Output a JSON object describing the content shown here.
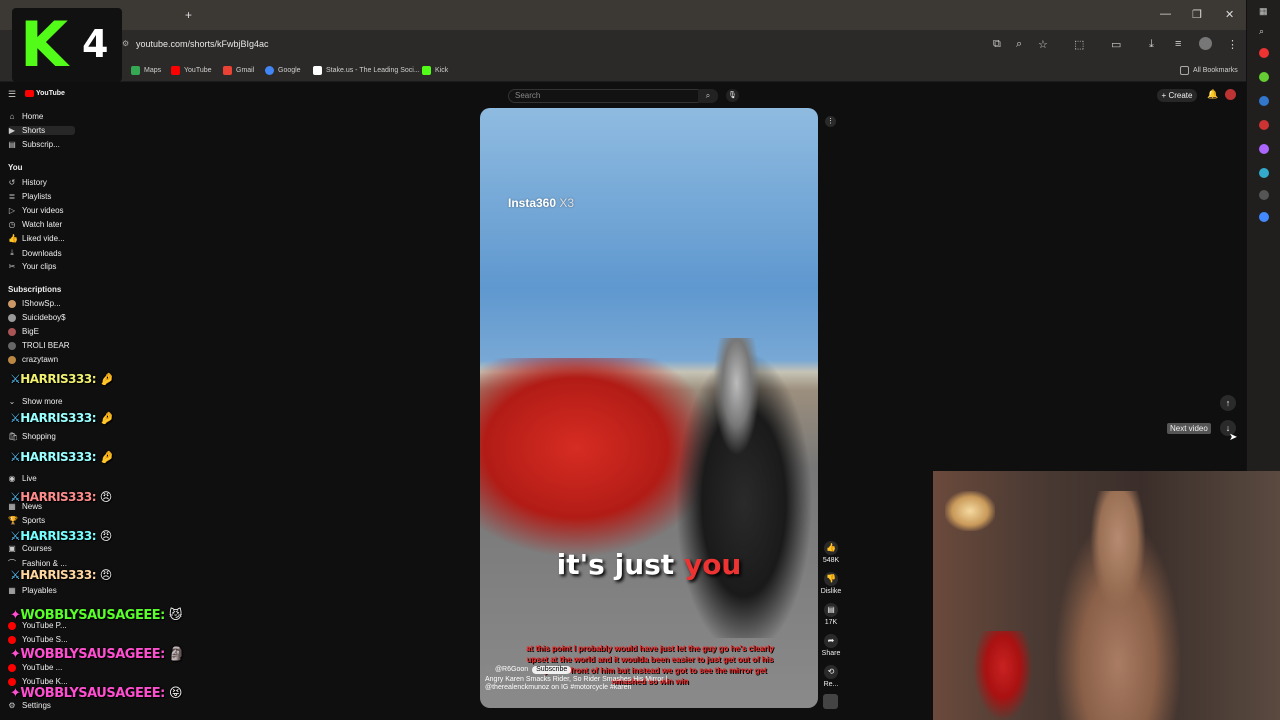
{
  "browser": {
    "url": "youtube.com/shorts/kFwbjBIg4ac",
    "new_tab": "+",
    "bookmarks": [
      "Maps",
      "YouTube",
      "Gmail",
      "Google",
      "Stake.us - The Leading Soci...",
      "Kick"
    ],
    "all_bookmarks": "All Bookmarks",
    "window_controls": [
      "—",
      "❐",
      "✕"
    ]
  },
  "logo": {
    "letter": "K",
    "number": "4"
  },
  "youtube": {
    "brand": "YouTube",
    "search_placeholder": "Search",
    "create_label": "+ Create"
  },
  "sidebar": {
    "top": [
      "Home",
      "Shorts",
      "Subscrip..."
    ],
    "you_header": "You",
    "you_items": [
      "History",
      "Playlists",
      "Your videos",
      "Watch later",
      "Liked vide...",
      "Downloads",
      "Your clips"
    ],
    "subs_header": "Subscriptions",
    "subs": [
      "IShowSp...",
      "Suicideboy$",
      "BigE",
      "TROLI BEAR",
      "crazytawn"
    ],
    "show_more": "Show more",
    "explore_items": [
      "Shopping",
      "Live",
      "News",
      "Sports",
      "Courses",
      "Fashion & ...",
      "Playables"
    ],
    "more_items": [
      "YouTube P...",
      "YouTube S...",
      "YouTube ...",
      "YouTube K..."
    ],
    "settings": "Settings"
  },
  "chat": {
    "lines": [
      {
        "name": "HARRIS333:",
        "color": "#f0f070"
      },
      {
        "name": "HARRIS333:",
        "color": "#f0f070"
      },
      {
        "name": "HARRIS333:",
        "color": "#f0f070"
      },
      {
        "name": "HARRIS333:",
        "color": "#ff8c8c"
      },
      {
        "name": "HARRIS333:",
        "color": "#ff8c8c"
      },
      {
        "name": "HARRIS333:",
        "color": "#ff8c8c"
      },
      {
        "name": "WOBBLYSAUSAGEEE:",
        "color": "#58ff2a"
      },
      {
        "name": "WOBBLYSAUSAGEEE:",
        "color": "#ff4fd0"
      },
      {
        "name": "WOBBLYSAUSAGEEE:",
        "color": "#ff4fd0"
      }
    ]
  },
  "video": {
    "watermark": "Insta360",
    "watermark_model": "X3",
    "caption_a": "it's just",
    "caption_b": "you",
    "red_subtitle": "at this point I probably would have just let the guy go he's clearly upset at the world and it woulda been easier to just get out of his way or in front of him but instead we got to see the mirror get smashed so win win",
    "channel": "@R6Goon",
    "subscribe": "Subscribe",
    "title": "Angry Karen Smacks Rider, So Rider Smashes His Mirror | @therealenckmunoz on IG #motorcycle #karen"
  },
  "actions": {
    "likes": "548K",
    "dislike": "Dislike",
    "comments": "17K",
    "share": "Share",
    "remix": "Re..."
  },
  "nav": {
    "next_tooltip": "Next video"
  },
  "colors": {
    "kick_green": "#53fc18",
    "yt_red": "#ff0000",
    "caption_red": "#e33"
  }
}
